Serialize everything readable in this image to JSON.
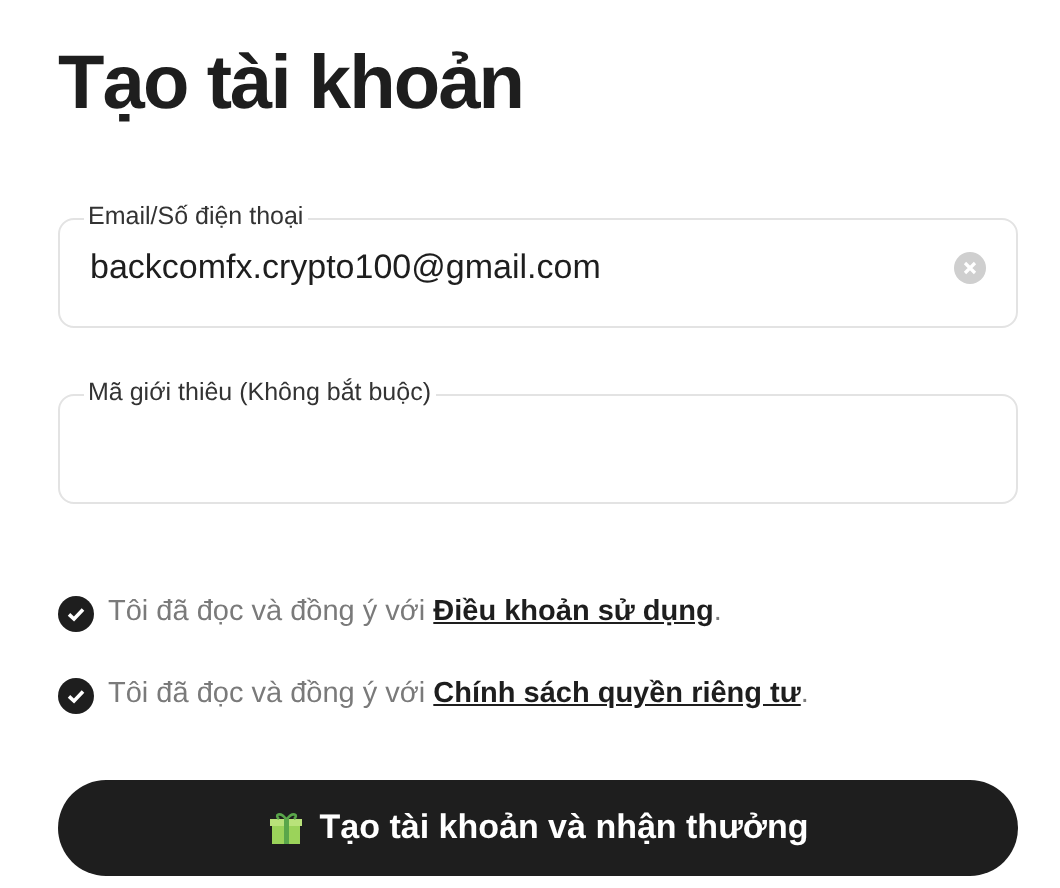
{
  "title": "Tạo tài khoản",
  "fields": [
    {
      "label": "Email/Số điện thoại",
      "value": "backcomfx.crypto100@gmail.com",
      "clearable": true
    },
    {
      "label": "Mã giới thiêu (Không bắt buộc)",
      "clearable": false
    }
  ],
  "agreements": [
    {
      "text": "Tôi đã đọc và đồng ý với ",
      "link": "Điều khoản sử dụng",
      "suffix": ".",
      "checked": true
    },
    {
      "text": "Tôi đã đọc và đồng ý với ",
      "link": "Chính sách quyền riêng tư",
      "suffix": ".",
      "checked": true
    }
  ],
  "submit_button": "Tạo tài khoản và nhận thưởng"
}
